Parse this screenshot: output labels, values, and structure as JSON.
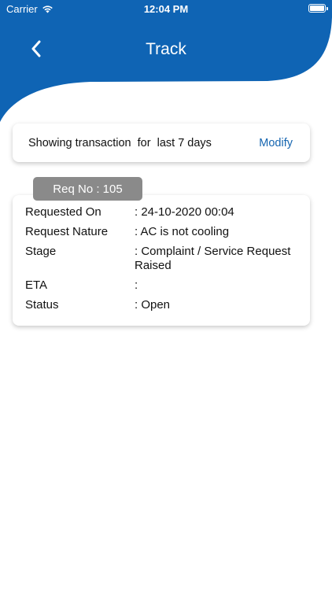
{
  "status_bar": {
    "carrier": "Carrier",
    "time": "12:04 PM"
  },
  "nav": {
    "title": "Track"
  },
  "filter": {
    "text": "Showing transaction  for  last 7 days",
    "modify_label": "Modify"
  },
  "request": {
    "tag": "Req No : 105",
    "rows": [
      {
        "label": "Requested On",
        "value": ": 24-10-2020 00:04"
      },
      {
        "label": "Request Nature",
        "value": ": AC is not cooling"
      },
      {
        "label": "Stage",
        "value": ": Complaint / Service Request Raised"
      },
      {
        "label": "ETA",
        "value": ":"
      },
      {
        "label": "Status",
        "value": ": Open"
      }
    ]
  },
  "colors": {
    "header_blue": "#0f64b4",
    "link_blue": "#1565b0",
    "tag_gray": "#8a8a8a"
  },
  "icons": {
    "back": "chevron-left-icon",
    "wifi": "wifi-icon",
    "battery": "battery-icon"
  }
}
